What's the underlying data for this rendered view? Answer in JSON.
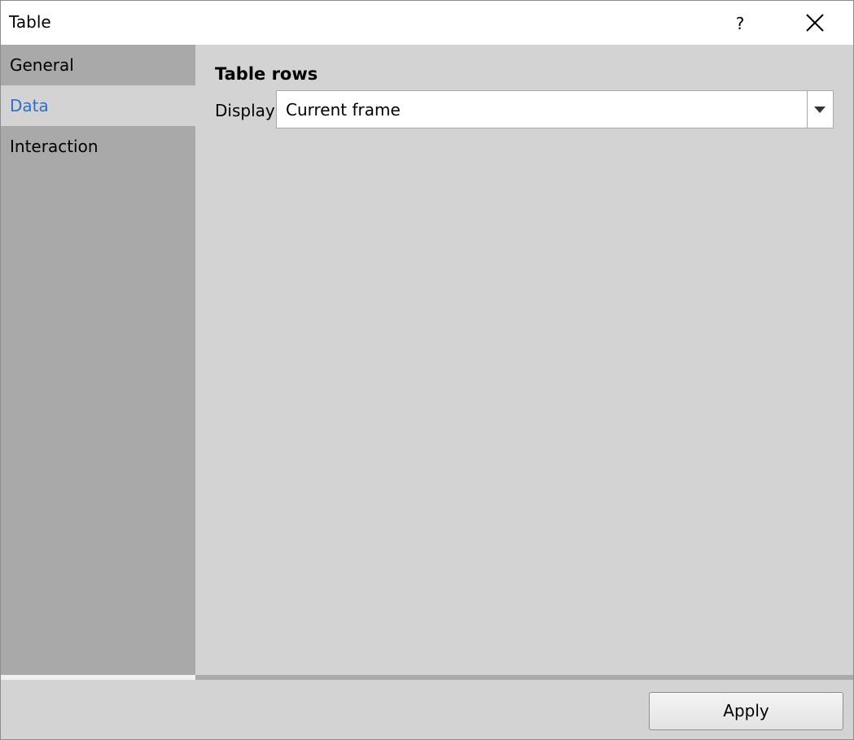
{
  "window": {
    "title": "Table",
    "help_label": "?"
  },
  "sidebar": {
    "items": [
      {
        "label": "General",
        "selected": false
      },
      {
        "label": "Data",
        "selected": true
      },
      {
        "label": "Interaction",
        "selected": false
      }
    ]
  },
  "main": {
    "section_title": "Table rows",
    "display_label": "Display",
    "display_value": "Current frame"
  },
  "footer": {
    "apply_label": "Apply"
  },
  "colors": {
    "sidebar_bg": "#a9a9a9",
    "content_bg": "#d3d3d3",
    "selected_text": "#2e6fc9"
  },
  "icons": {
    "close": "close-icon",
    "dropdown": "chevron-down-icon"
  }
}
